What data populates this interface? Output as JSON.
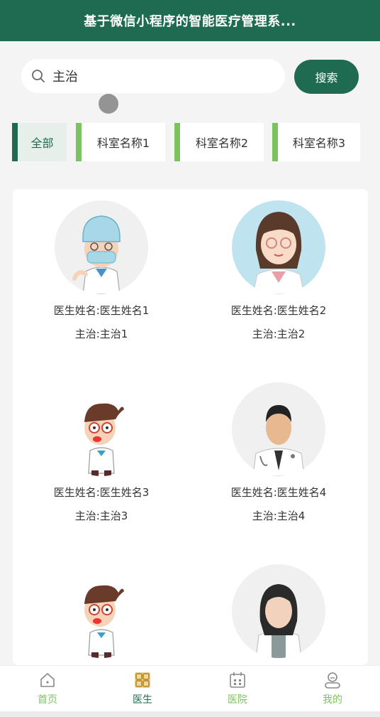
{
  "header": {
    "title": "基于微信小程序的智能医疗管理系..."
  },
  "search": {
    "value": "主治",
    "button_label": "搜索"
  },
  "tabs": [
    {
      "label": "全部"
    },
    {
      "label": "科室名称1"
    },
    {
      "label": "科室名称2"
    },
    {
      "label": "科室名称3"
    }
  ],
  "doctors": [
    {
      "name": "医生姓名:医生姓名1",
      "specialty": "主治:主治1"
    },
    {
      "name": "医生姓名:医生姓名2",
      "specialty": "主治:主治2"
    },
    {
      "name": "医生姓名:医生姓名3",
      "specialty": "主治:主治3"
    },
    {
      "name": "医生姓名:医生姓名4",
      "specialty": "主治:主治4"
    },
    {
      "name": "",
      "specialty": ""
    },
    {
      "name": "",
      "specialty": ""
    }
  ],
  "tabbar": [
    {
      "label": "首页",
      "icon": "home-icon"
    },
    {
      "label": "医生",
      "icon": "grid-icon"
    },
    {
      "label": "医院",
      "icon": "calendar-icon"
    },
    {
      "label": "我的",
      "icon": "user-icon"
    }
  ],
  "colors": {
    "primary": "#1f6b52",
    "accent": "#7cc35f"
  }
}
